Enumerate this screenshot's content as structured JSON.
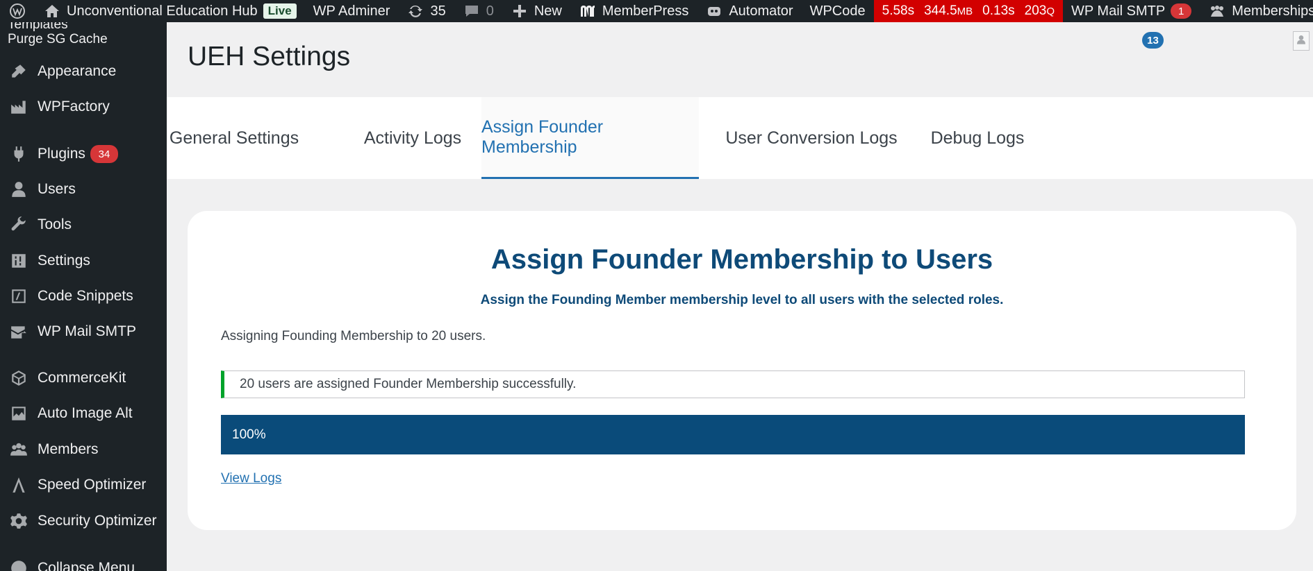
{
  "adminbar": {
    "site_name": "Unconventional Education Hub",
    "live_badge": "Live",
    "wp_adminer": "WP Adminer",
    "updates_count": "35",
    "comments_count": "0",
    "new_label": "New",
    "memberpress": "MemberPress",
    "automator": "Automator",
    "wpcode": "WPCode",
    "perf": {
      "time": "5.58s",
      "memory": "344.5",
      "memory_unit": "MB",
      "query_time": "0.13s",
      "queries": "203",
      "queries_unit": "Q"
    },
    "wp_mail_smtp": "WP Mail SMTP",
    "wp_mail_smtp_count": "1",
    "memberships": "Memberships"
  },
  "sidebar": {
    "top_partial": "Templates",
    "purge_cache": "Purge SG Cache",
    "items": [
      {
        "label": "Appearance",
        "icon": "paintbrush-icon"
      },
      {
        "label": "WPFactory",
        "icon": "factory-icon"
      },
      {
        "label": "Plugins",
        "icon": "plugin-icon",
        "badge": "34"
      },
      {
        "label": "Users",
        "icon": "user-icon"
      },
      {
        "label": "Tools",
        "icon": "wrench-icon"
      },
      {
        "label": "Settings",
        "icon": "sliders-icon"
      },
      {
        "label": "Code Snippets",
        "icon": "code-icon"
      },
      {
        "label": "WP Mail SMTP",
        "icon": "mail-icon"
      },
      {
        "label": "CommerceKit",
        "icon": "cube-icon"
      },
      {
        "label": "Auto Image Alt",
        "icon": "image-icon"
      },
      {
        "label": "Members",
        "icon": "group-icon"
      },
      {
        "label": "Speed Optimizer",
        "icon": "speed-icon"
      },
      {
        "label": "Security Optimizer",
        "icon": "gear-icon"
      }
    ],
    "collapse": "Collapse Menu"
  },
  "header": {
    "title": "UEH Settings",
    "notification_count": "13"
  },
  "tabs": [
    {
      "label": "General Settings"
    },
    {
      "label": "Activity Logs"
    },
    {
      "label": "Assign Founder Membership",
      "active": true
    },
    {
      "label": "User Conversion Logs"
    },
    {
      "label": "Debug Logs"
    }
  ],
  "card": {
    "title": "Assign Founder Membership to Users",
    "subtitle": "Assign the Founding Member membership level to all users with the selected roles.",
    "status": "Assigning Founding Membership to 20 users.",
    "notice": "20 users are assigned Founder Membership successfully.",
    "progress_label": "100%",
    "progress_value": 100,
    "view_logs": "View Logs"
  },
  "colors": {
    "accent": "#2271b1",
    "heading": "#0e4a78",
    "progress": "#0a4b7a",
    "success": "#00a32a",
    "danger": "#d63638"
  }
}
